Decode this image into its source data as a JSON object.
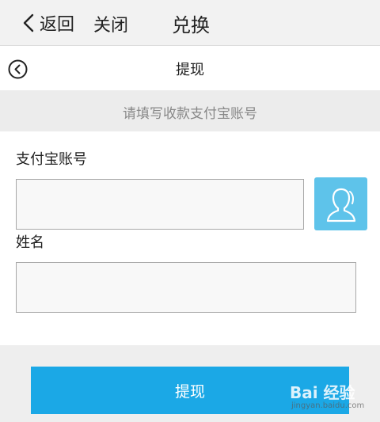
{
  "nav": {
    "back_label": "返回",
    "close_label": "关闭",
    "title": "兑换"
  },
  "page": {
    "title": "提现"
  },
  "hint": {
    "text": "请填写收款支付宝账号"
  },
  "form": {
    "alipay_label": "支付宝账号",
    "alipay_value": "",
    "name_label": "姓名",
    "name_value": ""
  },
  "submit": {
    "label": "提现"
  },
  "icons": {
    "back": "chevron-left-icon",
    "circle_back": "circle-chevron-left-icon",
    "contact": "contact-person-icon"
  },
  "colors": {
    "accent": "#1ba8e6",
    "contact_button": "#5ec3ea"
  },
  "watermark": {
    "logo": "Bai 经验",
    "url": "jingyan.baidu.com"
  }
}
